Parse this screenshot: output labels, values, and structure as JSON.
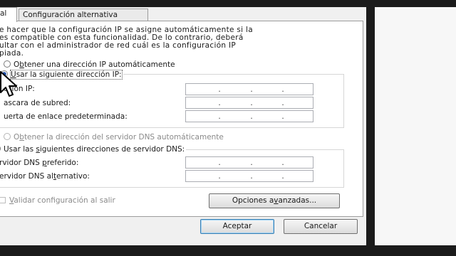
{
  "tabs": {
    "general": "al",
    "alternate": "Configuración alternativa"
  },
  "description": [
    "e hacer que la configuración IP se asigne automáticamente si la",
    "es compatible con esta funcionalidad. De lo contrario, deberá",
    "ultar con el administrador de red cuál es la configuración IP",
    "piada."
  ],
  "ip_section": {
    "auto_label_start": "O",
    "auto_label_key": "b",
    "auto_label_end": "tener una dirección IP automáticamente",
    "manual_label_start": "",
    "manual_label_key": "U",
    "manual_label_end": "sar la siguiente dirección IP:",
    "manual_selected": true,
    "fields": [
      {
        "label": "cción IP:"
      },
      {
        "label": "ascara de subred:"
      },
      {
        "label": "uerta de enlace predeterminada:"
      }
    ]
  },
  "dns_section": {
    "auto_label_start": "O",
    "auto_label_key": "b",
    "auto_label_end": "tener la dirección del servidor DNS automáticamente",
    "manual_label_start": "Usar las ",
    "manual_label_key": "s",
    "manual_label_end": "iguientes direcciones de servidor DNS:",
    "manual_selected": true,
    "fields": [
      {
        "label_start": "rvidor DNS ",
        "label_key": "p",
        "label_end": "referido:"
      },
      {
        "label_start": "ervidor DNS al",
        "label_key": "t",
        "label_end": "ernativo:"
      }
    ]
  },
  "validate": {
    "start": "",
    "key": "V",
    "end": "alidar configuración al salir",
    "checked": false
  },
  "buttons": {
    "advanced_start": "Opciones a",
    "advanced_key": "v",
    "advanced_end": "anzadas...",
    "accept": "Aceptar",
    "cancel": "Cancelar"
  },
  "colors": {
    "panel": "#ffffff",
    "dialog": "#f0f0f0",
    "frame": "#1b1b1b",
    "radio_dot": "#1e4fa8"
  }
}
